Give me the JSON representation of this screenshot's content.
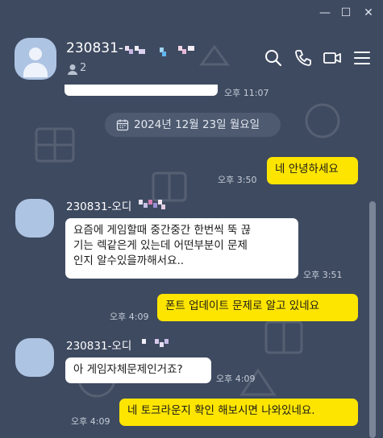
{
  "window": {
    "minimize_glyph": "—",
    "maximize_glyph": "☐",
    "close_glyph": "✕"
  },
  "header": {
    "chat_name": "230831-",
    "member_count": "2",
    "icons": [
      "search-icon",
      "call-icon",
      "video-icon",
      "menu-icon"
    ]
  },
  "prior_message": {
    "time": "오후 11:07"
  },
  "date_divider": {
    "label": "2024년 12월 23일 월요일"
  },
  "messages": [
    {
      "from": "me",
      "text": "네 안녕하세요",
      "time": "오후 3:50"
    },
    {
      "from": "them",
      "sender": "230831-오디",
      "lines": [
        "요즘에 게임할때 중간중간 한번씩 뚝 끊",
        "기는 렉같은게 있는데 어떤부분이 문제",
        "인지 알수있을까해서요.."
      ],
      "time": "오후 3:51"
    },
    {
      "from": "me",
      "text": "폰트 업데이트 문제로 알고 있네요",
      "time": "오후 4:09"
    },
    {
      "from": "them",
      "sender": "230831-오디",
      "text": "아 게임자체문제인거죠?",
      "time": "오후 4:09"
    },
    {
      "from": "me",
      "text": "네 토크라운지 확인 해보시면 나와있네요.",
      "time": "오후 4:09"
    }
  ],
  "colors": {
    "background": "#3e4a60",
    "my_bubble": "#fee500",
    "their_bubble": "#ffffff",
    "avatar": "#aec4e3"
  }
}
